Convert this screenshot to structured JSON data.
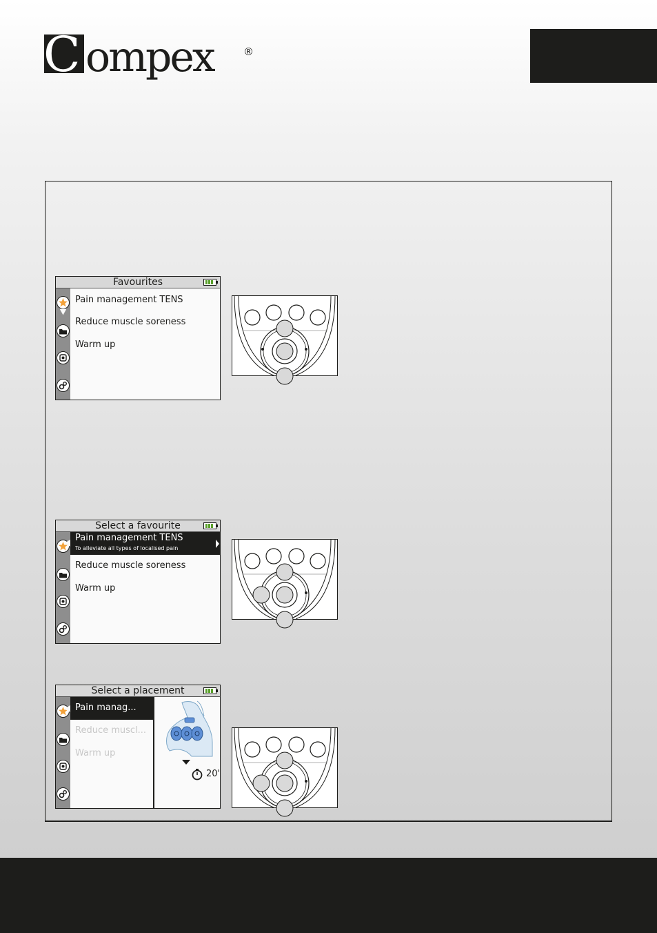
{
  "brand": {
    "name": "Compex",
    "registered_mark": "®"
  },
  "screens": [
    {
      "title": "Favourites",
      "items": [
        {
          "label": "Pain management TENS"
        },
        {
          "label": "Reduce muscle soreness"
        },
        {
          "label": "Warm up"
        }
      ]
    },
    {
      "title": "Select a favourite",
      "items": [
        {
          "label": "Pain management TENS",
          "subtitle": "To alleviate all types of localised pain"
        },
        {
          "label": "Reduce muscle soreness"
        },
        {
          "label": "Warm up"
        }
      ]
    },
    {
      "title": "Select a placement",
      "items": [
        {
          "label": "Pain manag..."
        },
        {
          "label": "Reduce muscl..."
        },
        {
          "label": "Warm up"
        }
      ],
      "timer": "20'"
    }
  ],
  "icons": [
    "star-icon",
    "folder-icon",
    "programs-icon",
    "settings-icon"
  ],
  "colors": {
    "star": "#f3a23a",
    "battery": "#5aa02c",
    "dark": "#1d1d1b",
    "electrode": "#5e8fd6"
  }
}
